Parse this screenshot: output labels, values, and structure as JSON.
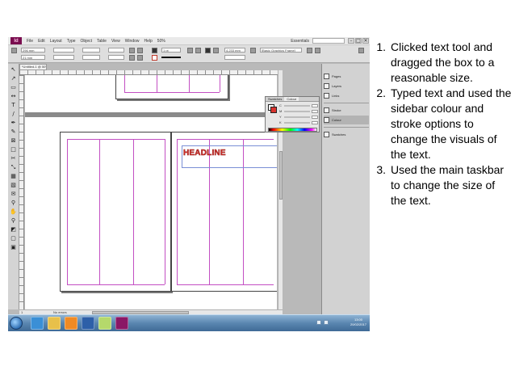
{
  "menubar": {
    "app_logo": "Id",
    "items": [
      "File",
      "Edit",
      "Layout",
      "Type",
      "Object",
      "Table",
      "View",
      "Window",
      "Help"
    ],
    "zoom": "50%",
    "workspace": "Essentials",
    "window_buttons": [
      "–",
      "□",
      "✕"
    ]
  },
  "control_bar": {
    "x_value": "296 mm",
    "y_value": "21 mm",
    "stroke_weight": "1 pt",
    "measure_value": "4.233 mm",
    "frame_style": "[Basic Graphics Frame]"
  },
  "document": {
    "tab_label": "*Untitled-1 @ 50%"
  },
  "tools": [
    {
      "name": "selection-tool",
      "glyph": "↖"
    },
    {
      "name": "direct-selection-tool",
      "glyph": "↗"
    },
    {
      "name": "page-tool",
      "glyph": "▭"
    },
    {
      "name": "gap-tool",
      "glyph": "↔"
    },
    {
      "name": "type-tool",
      "glyph": "T"
    },
    {
      "name": "line-tool",
      "glyph": "/"
    },
    {
      "name": "pen-tool",
      "glyph": "✒"
    },
    {
      "name": "pencil-tool",
      "glyph": "✎"
    },
    {
      "name": "rectangle-frame-tool",
      "glyph": "⊠"
    },
    {
      "name": "rectangle-tool",
      "glyph": "□"
    },
    {
      "name": "scissors-tool",
      "glyph": "✂"
    },
    {
      "name": "free-transform-tool",
      "glyph": "⤡"
    },
    {
      "name": "gradient-swatch-tool",
      "glyph": "▦"
    },
    {
      "name": "gradient-feather-tool",
      "glyph": "▧"
    },
    {
      "name": "note-tool",
      "glyph": "✉"
    },
    {
      "name": "eyedropper-tool",
      "glyph": "⚲"
    },
    {
      "name": "hand-tool",
      "glyph": "✋"
    },
    {
      "name": "zoom-tool",
      "glyph": "⚲"
    },
    {
      "name": "fill-stroke-swatch",
      "glyph": "◩"
    },
    {
      "name": "formatting-affects-container",
      "glyph": "▢"
    },
    {
      "name": "normal-view-mode",
      "glyph": "▣"
    }
  ],
  "canvas": {
    "headline_text": "HEADLINE",
    "status": {
      "page_number": "1",
      "preflight": "No errors"
    }
  },
  "colour_panel": {
    "tabs": [
      "Swatches",
      "Colour"
    ],
    "channels": [
      "C",
      "M",
      "Y",
      "K"
    ]
  },
  "dock": {
    "items": [
      {
        "icon": "pages-icon",
        "label": "Pages"
      },
      {
        "icon": "layers-icon",
        "label": "Layers"
      },
      {
        "icon": "links-icon",
        "label": "Links"
      },
      {
        "icon": "stroke-icon",
        "label": "Stroke"
      },
      {
        "icon": "colour-icon",
        "label": "Colour"
      },
      {
        "icon": "swatches-icon",
        "label": "Swatches"
      }
    ]
  },
  "taskbar": {
    "apps": [
      {
        "name": "ie-button",
        "color": "#3a8fd6"
      },
      {
        "name": "explorer-button",
        "color": "#e8c04a"
      },
      {
        "name": "media-player-button",
        "color": "#f08a24"
      },
      {
        "name": "photoshop-button",
        "color": "#2d5fa8"
      },
      {
        "name": "paint-button",
        "color": "#b5d96b"
      },
      {
        "name": "indesign-button",
        "color": "#8a1766"
      }
    ],
    "clock_time": "13:00",
    "clock_date": "20/02/2017"
  },
  "steps": [
    {
      "number": "1.",
      "text": "Clicked text tool and dragged the box to a reasonable size."
    },
    {
      "number": "2.",
      "text": "Typed text and used the sidebar colour and stroke options to change the visuals of the text."
    },
    {
      "number": "3.",
      "text": "Used the main taskbar to change the size of the text."
    }
  ]
}
